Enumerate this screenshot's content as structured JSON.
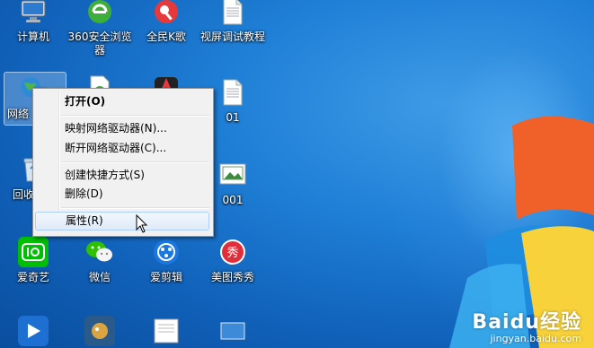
{
  "desktop": {
    "icons": [
      {
        "label": "计算机",
        "icon": "computer-icon"
      },
      {
        "label": "360安全浏览器",
        "icon": "360-browser-icon"
      },
      {
        "label": "全民K歌",
        "icon": "karaoke-icon"
      },
      {
        "label": "视屏调试教程",
        "icon": "document-icon"
      },
      {
        "label": "网络",
        "icon": "network-icon"
      },
      {
        "label": "回收站",
        "icon": "recycle-bin-icon"
      },
      {
        "label": "01",
        "icon": "document-icon"
      },
      {
        "label": "001",
        "icon": "image-file-icon"
      },
      {
        "label": "爱奇艺",
        "icon": "iqiyi-icon"
      },
      {
        "label": "微信",
        "icon": "wechat-icon"
      },
      {
        "label": "爱剪辑",
        "icon": "aijianji-icon"
      },
      {
        "label": "美图秀秀",
        "icon": "meitu-icon"
      }
    ]
  },
  "context_menu": {
    "open": "打开(O)",
    "map_drive": "映射网络驱动器(N)...",
    "disconnect_drive": "断开网络驱动器(C)...",
    "create_shortcut": "创建快捷方式(S)",
    "delete": "删除(D)",
    "properties": "属性(R)"
  },
  "watermark": {
    "brand": "Baidu经验",
    "url": "jingyan.baidu.com"
  },
  "colors": {
    "desktop_blue": "#1f7fd6",
    "menu_bg": "#f1f1f1",
    "menu_hover": "#dfeaf8",
    "iqiyi_green": "#00be06",
    "wechat_green": "#2dc100",
    "meitu_red": "#e02f3a"
  }
}
